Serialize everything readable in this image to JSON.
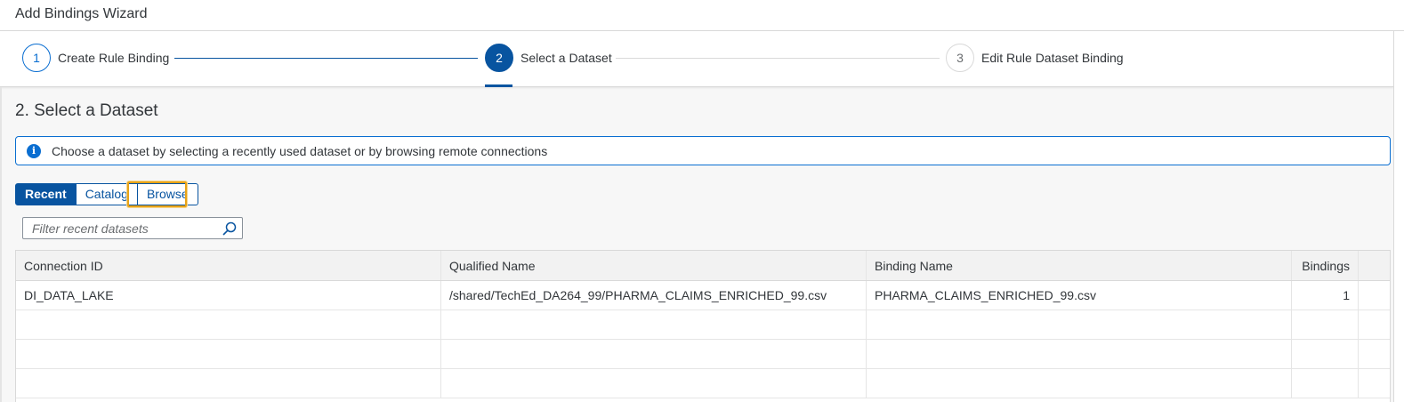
{
  "window": {
    "title": "Add Bindings Wizard"
  },
  "wizard": {
    "steps": [
      {
        "number": "1",
        "label": "Create Rule Binding",
        "state": "completed"
      },
      {
        "number": "2",
        "label": "Select a Dataset",
        "state": "active"
      },
      {
        "number": "3",
        "label": "Edit Rule Dataset Binding",
        "state": "upcoming"
      }
    ]
  },
  "section": {
    "title": "2. Select a Dataset"
  },
  "info": {
    "icon": "info-icon",
    "text": "Choose a dataset by selecting a recently used dataset or by browsing remote connections"
  },
  "source_tabs": {
    "items": [
      "Recent",
      "Catalog",
      "Browse"
    ],
    "selected": "Recent",
    "focused": "Browse"
  },
  "search": {
    "placeholder": "Filter recent datasets",
    "value": "",
    "icon": "search-icon"
  },
  "table": {
    "columns": [
      "Connection ID",
      "Qualified Name",
      "Binding Name",
      "Bindings"
    ],
    "rows": [
      [
        "DI_DATA_LAKE",
        "/shared/TechEd_DA264_99/PHARMA_CLAIMS_ENRICHED_99.csv",
        "PHARMA_CLAIMS_ENRICHED_99.csv",
        "1"
      ]
    ]
  },
  "colors": {
    "accent": "#0854a0",
    "link": "#0a6ed1",
    "focus": "#e8a317"
  }
}
